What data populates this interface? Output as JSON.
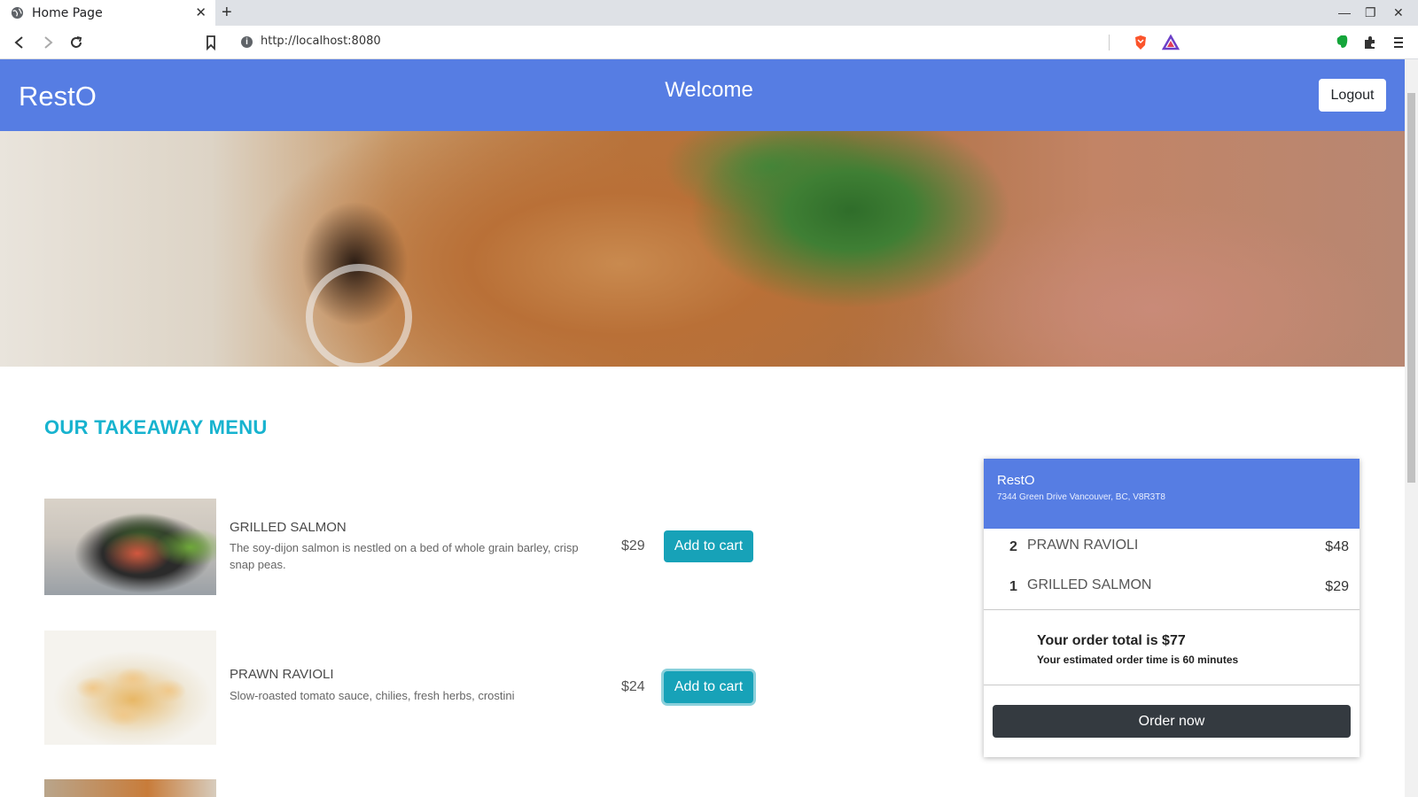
{
  "browser": {
    "tab_title": "Home Page",
    "url": "http://localhost:8080"
  },
  "header": {
    "brand": "RestO",
    "welcome": "Welcome",
    "logout_label": "Logout",
    "accent_color": "#567de3"
  },
  "menu": {
    "title": "OUR TAKEAWAY MENU",
    "add_label": "Add to cart",
    "items": [
      {
        "name": "GRILLED SALMON",
        "description": "The soy-dijon salmon is nestled on a bed of whole grain barley, crisp snap peas.",
        "price": "$29"
      },
      {
        "name": "PRAWN RAVIOLI",
        "description": "Slow-roasted tomato sauce, chilies, fresh herbs, crostini",
        "price": "$24"
      }
    ]
  },
  "cart": {
    "restaurant": "RestO",
    "address": "7344 Green Drive Vancouver, BC, V8R3T8",
    "items": [
      {
        "qty": "2",
        "name": "PRAWN RAVIOLI",
        "price": "$48"
      },
      {
        "qty": "1",
        "name": "GRILLED SALMON",
        "price": "$29"
      }
    ],
    "total_text": "Your order total is $77",
    "estimate_text": "Your estimated order time is 60 minutes",
    "order_label": "Order now"
  }
}
